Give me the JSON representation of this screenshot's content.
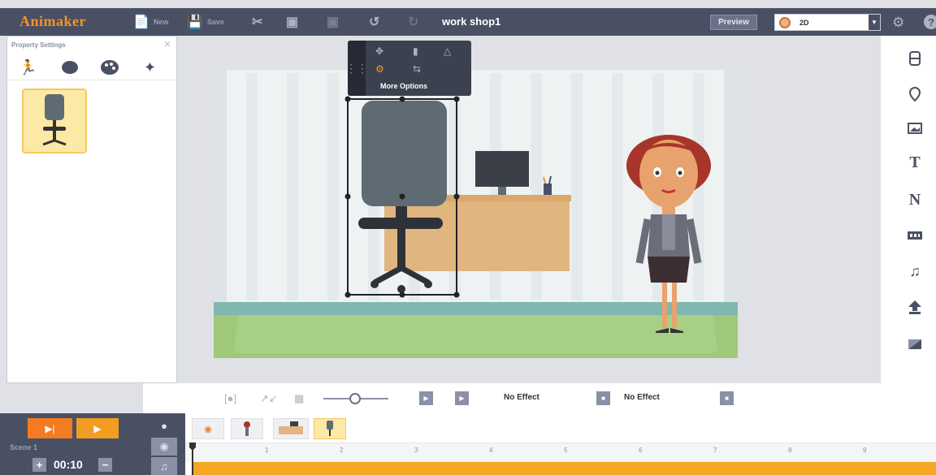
{
  "app": {
    "logo": "Animaker",
    "project_title": "work shop1"
  },
  "toolbar": {
    "new_label": "New",
    "save_label": "Save",
    "preview_label": "Preview",
    "mode_value": "2D"
  },
  "property_panel": {
    "title": "Property Settings",
    "tabs": [
      "character-icon",
      "shape-icon",
      "palette-icon",
      "magic-wand-icon"
    ],
    "selected_asset": "chair"
  },
  "object_menu": {
    "more_options_label": "More Options"
  },
  "right_rail": {
    "tools": [
      "scene-icon",
      "pin-icon",
      "image-icon",
      "text-icon",
      "number-icon",
      "video-icon",
      "music-icon",
      "upload-icon",
      "background-icon"
    ],
    "text_tool_label": "T",
    "number_tool_label": "N"
  },
  "effect_bar": {
    "enter_effect": "No Effect",
    "exit_effect": "No Effect"
  },
  "timeline": {
    "scene_label": "Scene 1",
    "duration": "00:10",
    "ticks": [
      "1",
      "2",
      "3",
      "4",
      "5",
      "6",
      "7",
      "8",
      "9"
    ],
    "items": [
      "eye-icon",
      "character-thumb",
      "desk-thumb",
      "chair-thumb"
    ]
  },
  "colors": {
    "accent": "#f39322",
    "toolbar": "#4a5064",
    "timeline_bar": "#f5a623"
  }
}
